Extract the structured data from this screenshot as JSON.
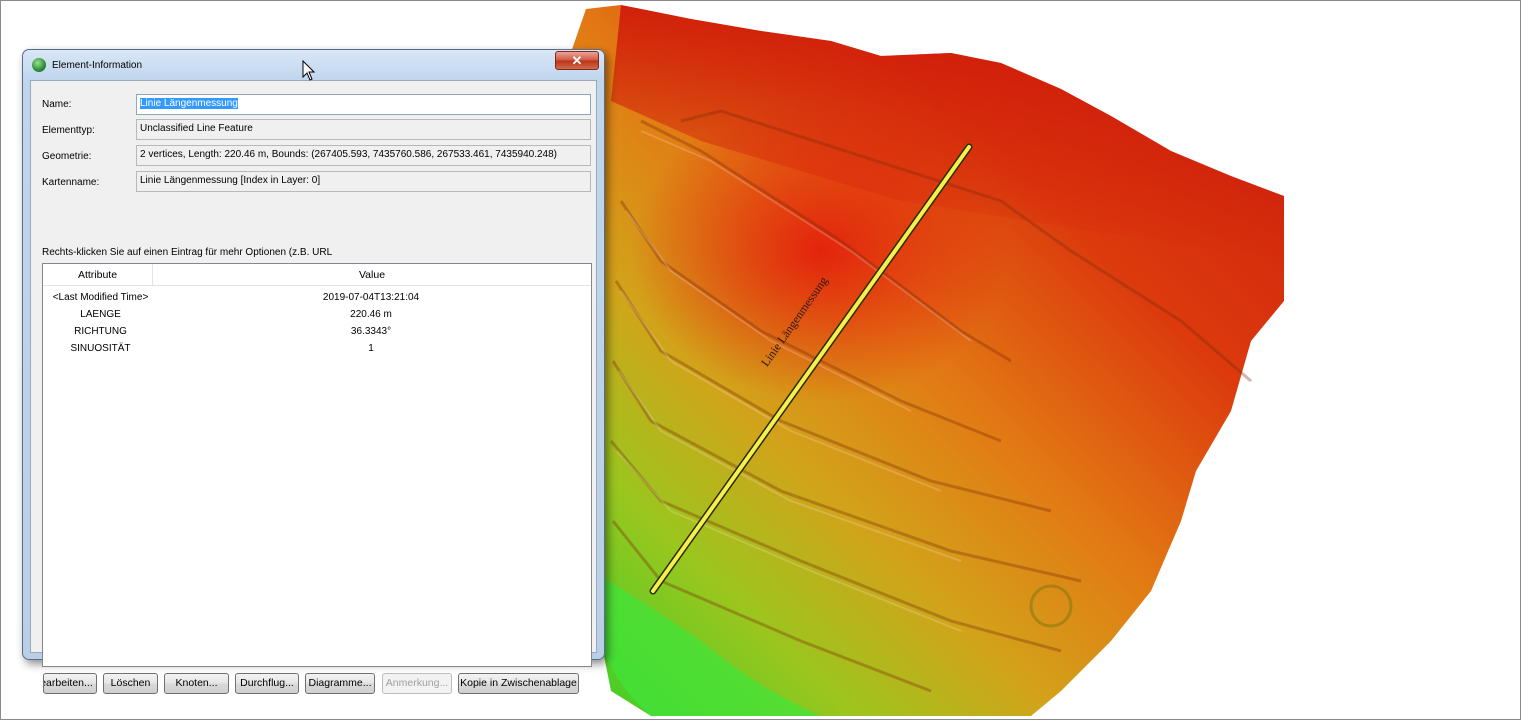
{
  "dialog": {
    "title": "Element-Information",
    "close_symbol": "✕",
    "fields": [
      {
        "label": "Name:",
        "value": "Linie Längenmessung"
      },
      {
        "label": "Elementtyp:",
        "value": "Unclassified Line Feature"
      },
      {
        "label": "Geometrie:",
        "value": "2 vertices, Length: 220.46 m, Bounds: (267405.593, 7435760.586, 267533.461, 7435940.248)"
      },
      {
        "label": "Kartenname:",
        "value": "Linie Längenmessung [Index in Layer: 0]"
      }
    ],
    "hint": "Rechts-klicken Sie auf einen Eintrag für mehr Optionen (z.B. URL",
    "table": {
      "columns": [
        "Attribute",
        "Value"
      ],
      "rows": [
        {
          "attribute": "<Last Modified Time>",
          "value": "2019-07-04T13:21:04"
        },
        {
          "attribute": "LAENGE",
          "value": "220.46 m"
        },
        {
          "attribute": "RICHTUNG",
          "value": "36.3343°"
        },
        {
          "attribute": "SINUOSITÄT",
          "value": "1"
        }
      ]
    },
    "buttons": {
      "edit": "Bearbeiten...",
      "delete": "Löschen",
      "vertices": "Knoten...",
      "flythrough": "Durchflug...",
      "charts": "Diagramme...",
      "annotation": "Anmerkung...",
      "copy": "Kopie in Zwischenablage"
    }
  },
  "map": {
    "line_label": "Linie Längenmessung"
  },
  "colors": {
    "terrain_high": "#d81b0b",
    "terrain_mid": "#e37a12",
    "terrain_low": "#2fd02a",
    "measure_line": "#f5f04a",
    "selection": "#3399ff"
  }
}
